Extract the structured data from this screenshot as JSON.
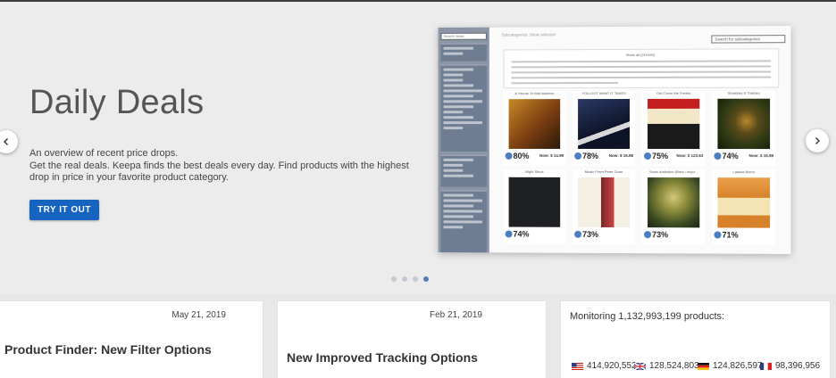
{
  "hero": {
    "title": "Daily Deals",
    "line1": "An overview of recent price drops.",
    "line2": "Get the real deals. Keepa finds the best deals every day. Find products with the highest drop in price in your favorite product category.",
    "cta_label": "TRY IT OUT",
    "slide_count": 4,
    "active_slide": 4
  },
  "preview": {
    "search_placeholder": "Search deals",
    "top_text": "Subcategories: Show selected",
    "subcategory_search": "Search for subcategories",
    "categories_title": "Show all (219160)",
    "products": [
      {
        "title": "A Tribute To Mal Waldron",
        "pct": "80%",
        "now": "Now: $ 14.99"
      },
      {
        "title": "YOU GOT WHAT IT TAKES",
        "pct": "78%",
        "now": "Now: $ 15.98"
      },
      {
        "title": "Out Come the Freaks",
        "pct": "75%",
        "now": "Now: $ 123.63"
      },
      {
        "title": "Smashes & Trashes",
        "pct": "74%",
        "now": "Now: $ 19.99"
      },
      {
        "title": "Night Steps",
        "pct": "74%",
        "now": ""
      },
      {
        "title": "Music From Peter Gunn",
        "pct": "73%",
        "now": ""
      },
      {
        "title": "Sonic Addiction (Rare / Impo...",
        "pct": "73%",
        "now": ""
      },
      {
        "title": "Latakia Blend",
        "pct": "71%",
        "now": ""
      }
    ]
  },
  "cards": [
    {
      "date": "May 21, 2019",
      "title": "Product Finder: New Filter Options"
    },
    {
      "date": "Feb 21, 2019",
      "title": "New Improved Tracking Options"
    }
  ],
  "monitoring": {
    "title": "Monitoring 1,132,993,199 products:",
    "stats": [
      {
        "flag": "us-flag",
        "value": "414,920,552"
      },
      {
        "flag": "uk-flag",
        "value": "128,524,803"
      },
      {
        "flag": "de-flag",
        "value": "124,826,597"
      },
      {
        "flag": "fr-flag",
        "value": "98,396,956"
      }
    ]
  },
  "colors": {
    "accent": "#1565c0",
    "dot_active": "#5b7bb3",
    "dot_inactive": "#c4c8d0"
  }
}
